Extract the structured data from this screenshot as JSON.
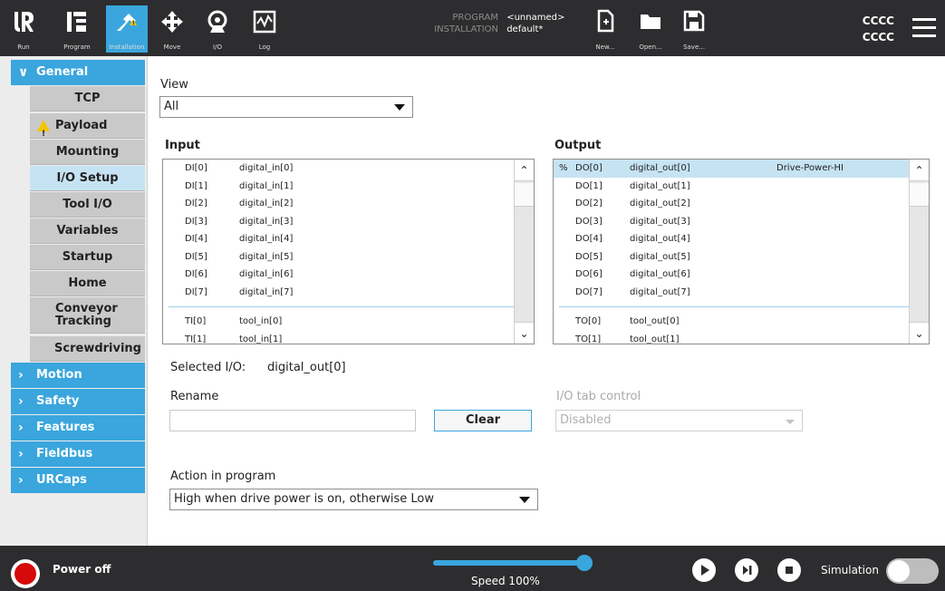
{
  "header": {
    "nav": [
      {
        "label": "Run",
        "icon": "ur-logo-icon"
      },
      {
        "label": "Program",
        "icon": "program-icon"
      },
      {
        "label": "Installation",
        "icon": "installation-icon"
      },
      {
        "label": "Move",
        "icon": "move-icon"
      },
      {
        "label": "I/O",
        "icon": "io-icon"
      },
      {
        "label": "Log",
        "icon": "log-icon"
      }
    ],
    "program_key": "PROGRAM",
    "program_value": "<unnamed>",
    "installation_key": "INSTALLATION",
    "installation_value": "default*",
    "file_buttons": [
      {
        "label": "New...",
        "icon": "new-file-icon"
      },
      {
        "label": "Open...",
        "icon": "open-folder-icon"
      },
      {
        "label": "Save...",
        "icon": "save-icon"
      }
    ],
    "user_line1": "CCCC",
    "user_line2": "CCCC"
  },
  "sidebar": {
    "general": "General",
    "items": [
      "TCP",
      "Payload",
      "Mounting",
      "I/O Setup",
      "Tool I/O",
      "Variables",
      "Startup",
      "Home",
      "Conveyor Tracking",
      "Screwdriving"
    ],
    "selected": "I/O Setup",
    "sections": [
      "Motion",
      "Safety",
      "Features",
      "Fieldbus",
      "URCaps"
    ]
  },
  "main": {
    "view_label": "View",
    "view_value": "All",
    "input_title": "Input",
    "output_title": "Output",
    "inputs": [
      {
        "id": "DI[0]",
        "name": "digital_in[0]"
      },
      {
        "id": "DI[1]",
        "name": "digital_in[1]"
      },
      {
        "id": "DI[2]",
        "name": "digital_in[2]"
      },
      {
        "id": "DI[3]",
        "name": "digital_in[3]"
      },
      {
        "id": "DI[4]",
        "name": "digital_in[4]"
      },
      {
        "id": "DI[5]",
        "name": "digital_in[5]"
      },
      {
        "id": "DI[6]",
        "name": "digital_in[6]"
      },
      {
        "id": "DI[7]",
        "name": "digital_in[7]"
      }
    ],
    "tool_inputs": [
      {
        "id": "TI[0]",
        "name": "tool_in[0]"
      },
      {
        "id": "TI[1]",
        "name": "tool_in[1]"
      }
    ],
    "outputs": [
      {
        "flag": "%",
        "id": "DO[0]",
        "name": "digital_out[0]",
        "action": "Drive-Power-HI"
      },
      {
        "flag": "",
        "id": "DO[1]",
        "name": "digital_out[1]",
        "action": ""
      },
      {
        "flag": "",
        "id": "DO[2]",
        "name": "digital_out[2]",
        "action": ""
      },
      {
        "flag": "",
        "id": "DO[3]",
        "name": "digital_out[3]",
        "action": ""
      },
      {
        "flag": "",
        "id": "DO[4]",
        "name": "digital_out[4]",
        "action": ""
      },
      {
        "flag": "",
        "id": "DO[5]",
        "name": "digital_out[5]",
        "action": ""
      },
      {
        "flag": "",
        "id": "DO[6]",
        "name": "digital_out[6]",
        "action": ""
      },
      {
        "flag": "",
        "id": "DO[7]",
        "name": "digital_out[7]",
        "action": ""
      }
    ],
    "tool_outputs": [
      {
        "id": "TO[0]",
        "name": "tool_out[0]"
      },
      {
        "id": "TO[1]",
        "name": "tool_out[1]"
      }
    ],
    "selected_io_label": "Selected I/O:",
    "selected_io_value": "digital_out[0]",
    "rename_label": "Rename",
    "rename_value": "",
    "clear_label": "Clear",
    "io_tab_label": "I/O tab control",
    "io_tab_value": "Disabled",
    "action_label": "Action in program",
    "action_value": "High when drive power is on, otherwise Low"
  },
  "footer": {
    "power_label": "Power off",
    "speed_label": "Speed 100%",
    "speed_fraction": 1.0,
    "simulation_label": "Simulation",
    "simulation_on": false
  },
  "colors": {
    "accent": "#3aa6dd",
    "header": "#2d2d2f",
    "power_off": "#d60a0a",
    "warning": "#f4c400"
  }
}
